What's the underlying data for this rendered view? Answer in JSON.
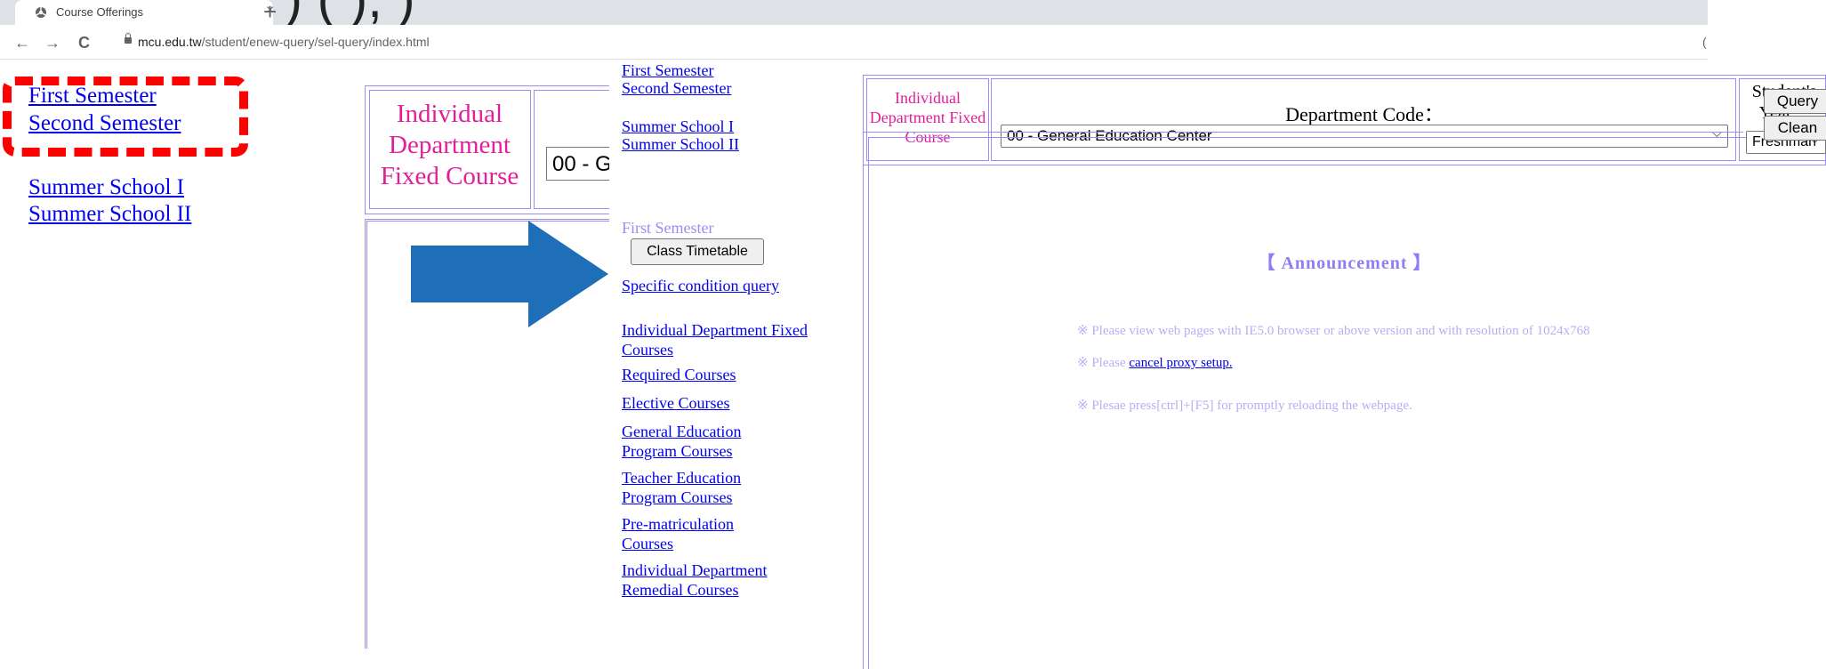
{
  "browser": {
    "tab_title": "Course Offerings",
    "tab_close": "×",
    "new_tab": "+",
    "url_domain": "mcu.edu.tw",
    "url_path": "/student/enew-query/sel-query/index.html",
    "back": "←",
    "forward": "→",
    "reload": "C",
    "right_partial": "(",
    "top_overlay_text": ")                                   (              ),                            )"
  },
  "background_page": {
    "semester_links": [
      "First Semester",
      "Second Semester"
    ],
    "summer_links": [
      "Summer School I",
      "Summer School II"
    ],
    "individual_dept_label": "Individual Department Fixed Course",
    "dept_select_partial": "00 - G"
  },
  "sidebar": {
    "top_links": [
      "First Semester",
      "Second Semester",
      "Summer School I",
      "Summer School II"
    ],
    "section_title": "First Semester",
    "class_timetable_button": "Class Timetable",
    "links": [
      "Specific condition query",
      "Individual Department Fixed Courses",
      "Required Courses",
      "Elective Courses",
      "General Education Program Courses",
      "Teacher Education Program Courses",
      "Pre-matriculation Courses",
      "Individual Department Remedial Courses"
    ]
  },
  "header": {
    "individual_dept_label": "Individual Department Fixed Course",
    "dept_code_label": "Department Code：",
    "dept_code_value": "00 - General Education Center",
    "student_year_label": "Student's Year：",
    "student_year_value": "Freshman",
    "query_button": "Query",
    "clean_button": "Clean"
  },
  "announcement": {
    "title": "【 Announcement 】",
    "line1": "※ Please view web pages with IE5.0 browser or above version and with resolution of 1024x768",
    "line2_prefix": "※ Please ",
    "line2_link": "cancel proxy setup.",
    "line3": "※ Plesae press[ctrl]+[F5] for promptly reloading the webpage."
  },
  "colors": {
    "link": "#0000ee",
    "magenta_label": "#e0209a",
    "frame_border": "#9f8cf0",
    "highlight_box": "#ff0000",
    "arrow": "#1f6fb8"
  },
  "icons": [
    "favicon-icon",
    "close-icon",
    "plus-icon",
    "back-arrow-icon",
    "forward-arrow-icon",
    "reload-icon",
    "lock-icon",
    "chevron-down-icon",
    "right-arrow-icon"
  ]
}
